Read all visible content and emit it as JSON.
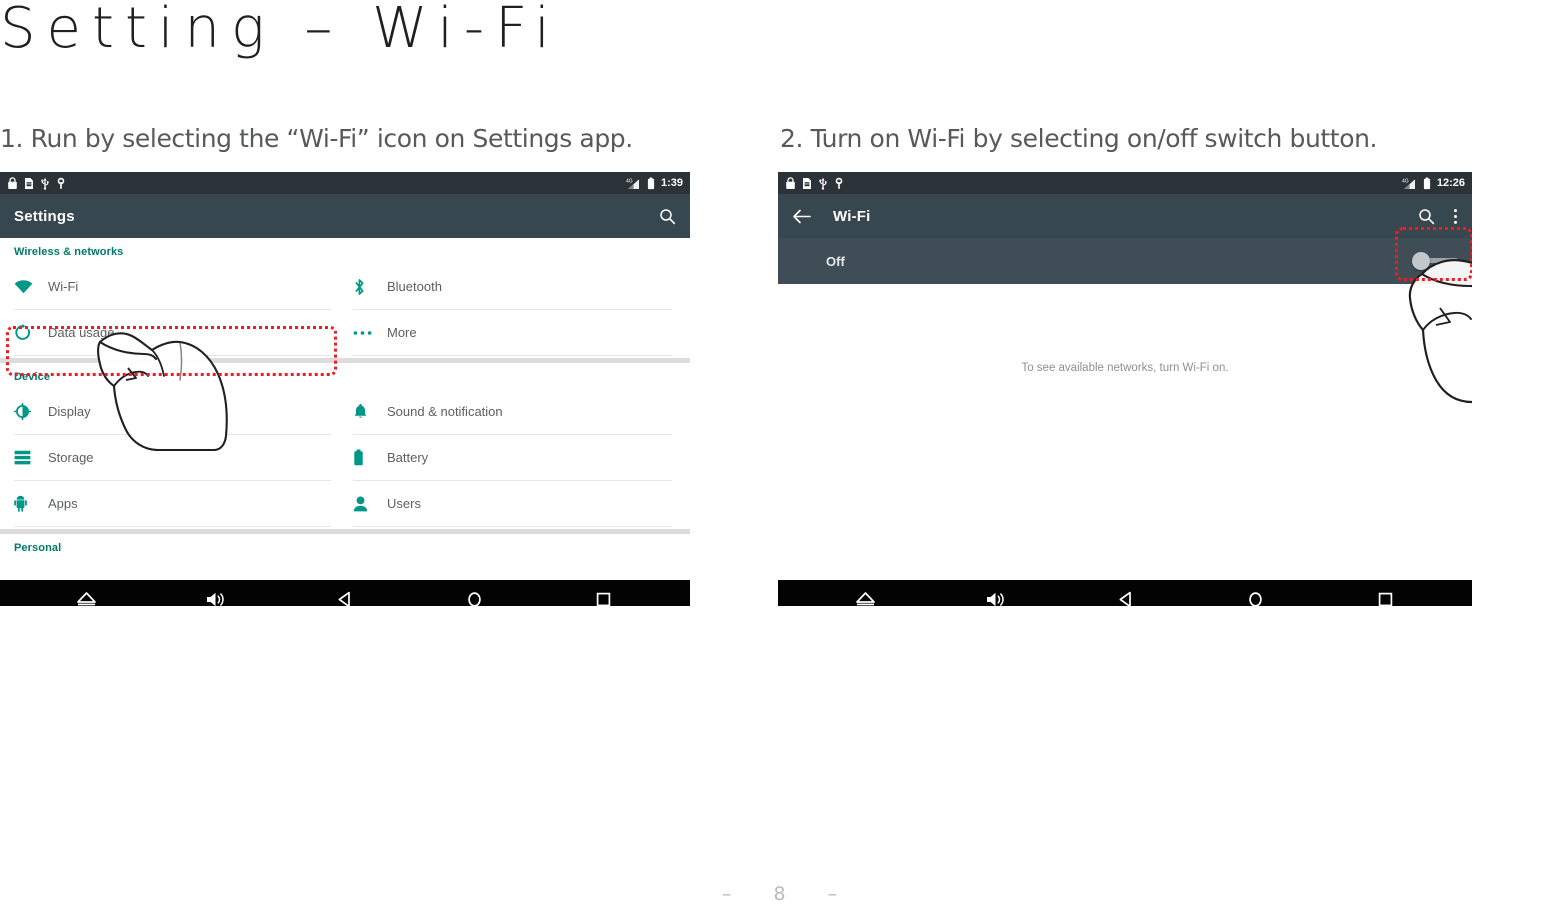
{
  "page": {
    "title": "Setting – Wi-Fi",
    "footer_page_number": "– 8 –"
  },
  "accent": {
    "teal": "#00796b",
    "highlight_red": "#ee1c25",
    "statusbar_bg": "#2b3238",
    "appbar_bg": "#37474f",
    "toggle_row_bg": "#3f4e56",
    "navbar_bg": "#030303"
  },
  "steps": [
    {
      "caption": "1. Run by selecting the “Wi-Fi” icon on Settings app."
    },
    {
      "caption": "2. Turn on Wi-Fi by selecting on/off switch button."
    }
  ],
  "screenshot_settings": {
    "statusbar": {
      "left_icons": [
        "lock-icon",
        "sim-card-icon",
        "usb-icon",
        "headset-icon"
      ],
      "right_icons": [
        "signal-4g-icon",
        "battery-icon"
      ],
      "clock": "1:39"
    },
    "appbar": {
      "title": "Settings",
      "actions": [
        "search-icon"
      ]
    },
    "sections": [
      {
        "header": "Wireless & networks",
        "rows_left": [
          {
            "label": "Wi-Fi",
            "icon": "wifi-icon",
            "highlighted": true
          },
          {
            "label": "Data usage",
            "icon": "data-usage-icon"
          }
        ],
        "rows_right": [
          {
            "label": "Bluetooth",
            "icon": "bluetooth-icon"
          },
          {
            "label": "More",
            "icon": "more-dots-icon"
          }
        ]
      },
      {
        "header": "Device",
        "rows_left": [
          {
            "label": "Display",
            "icon": "display-icon"
          },
          {
            "label": "Storage",
            "icon": "storage-icon"
          },
          {
            "label": "Apps",
            "icon": "apps-android-icon"
          }
        ],
        "rows_right": [
          {
            "label": "Sound & notification",
            "icon": "bell-icon"
          },
          {
            "label": "Battery",
            "icon": "battery-icon"
          },
          {
            "label": "Users",
            "icon": "person-icon"
          }
        ]
      },
      {
        "header": "Personal",
        "rows_left": [],
        "rows_right": []
      }
    ],
    "navbar": [
      "eject-icon",
      "volume-icon",
      "back-icon",
      "home-icon",
      "recents-icon"
    ]
  },
  "screenshot_wifi": {
    "statusbar": {
      "left_icons": [
        "lock-icon",
        "sim-card-icon",
        "usb-icon",
        "headset-icon"
      ],
      "right_icons": [
        "signal-4g-icon",
        "battery-icon"
      ],
      "clock": "12:26"
    },
    "appbar": {
      "back": "back-arrow-icon",
      "title": "Wi-Fi",
      "actions": [
        "search-icon",
        "overflow-menu-icon"
      ]
    },
    "toggle_row": {
      "label": "Off",
      "switch_state": "off"
    },
    "empty_text": "To see available networks, turn Wi-Fi on.",
    "navbar": [
      "eject-icon",
      "volume-icon",
      "back-icon",
      "home-icon",
      "recents-icon"
    ]
  }
}
